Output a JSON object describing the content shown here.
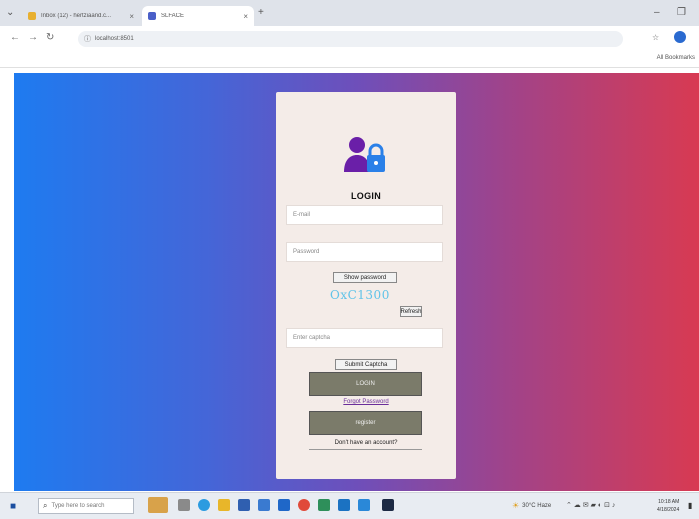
{
  "browser": {
    "tabs": [
      {
        "title": "Inbox (12) - hertziaand.c..."
      },
      {
        "title": "SLFACE"
      }
    ],
    "new_tab_label": "+",
    "minimize_label": "–",
    "restore_label": "❐",
    "url": "localhost:8501",
    "all_bookmarks_label": "All Bookmarks"
  },
  "login": {
    "title": "LOGIN",
    "email_placeholder": "E-mail",
    "password_placeholder": "Password",
    "show_password_label": "Show password",
    "captcha_text": "OxC1300",
    "refresh_label": "Refresh",
    "captcha_placeholder": "Enter captcha",
    "submit_captcha_label": "Submit Captcha",
    "login_button_label": "LOGIN",
    "forgot_password_label": "Forgot Password",
    "register_button_label": "register",
    "no_account_label": "Don't have an account?"
  },
  "taskbar": {
    "search_placeholder": "Type here to search",
    "weather": "30°C Haze",
    "time": "10:18 AM",
    "date": "4/18/2024"
  },
  "colors": {
    "gradient_left": "#1e7bf0",
    "gradient_right": "#d83a52",
    "card_background": "#f4ece8",
    "user_icon": "#6a1fa8",
    "lock_icon": "#2a80e8",
    "captcha_text": "#5fc3e8",
    "button_fill": "#7b7b6a"
  },
  "icons": [
    "user-lock-icon",
    "search-icon",
    "windows-start-icon",
    "lock-icon",
    "close-icon"
  ]
}
